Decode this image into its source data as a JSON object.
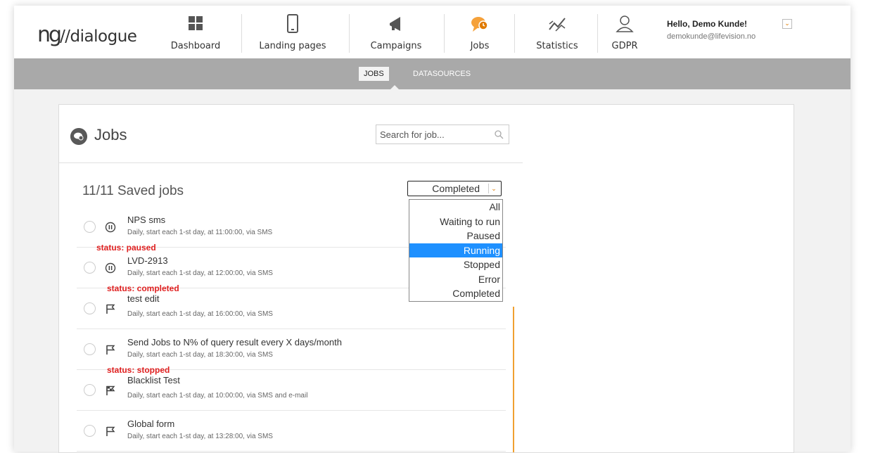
{
  "logo": {
    "prefix": "ng",
    "text": "//dialogue"
  },
  "nav": {
    "dashboard": "Dashboard",
    "landing_pages": "Landing pages",
    "campaigns": "Campaigns",
    "jobs": "Jobs",
    "statistics": "Statistics",
    "gdpr": "GDPR"
  },
  "user": {
    "greeting": "Hello, Demo Kunde!",
    "email": "demokunde@lifevision.no"
  },
  "subnav": {
    "jobs": "JOBS",
    "datasources": "DATASOURCES"
  },
  "jobs_panel": {
    "title": "Jobs",
    "search_placeholder": "Search for job...",
    "saved_title": "11/11 Saved jobs",
    "filter_value": "Completed",
    "filter_options": [
      "All",
      "Waiting to run",
      "Paused",
      "Running",
      "Stopped",
      "Error",
      "Completed"
    ]
  },
  "jobs": [
    {
      "name": "NPS sms",
      "desc": "Daily, start each 1-st day, at 11:00:00, via SMS",
      "icon": "pause-icon"
    },
    {
      "name": "LVD-2913",
      "desc": "Daily, start each 1-st day, at 12:00:00, via SMS",
      "icon": "pause-icon"
    },
    {
      "name": "test edit",
      "desc": "Daily, start each 1-st day, at 16:00:00, via SMS",
      "icon": "flag-icon"
    },
    {
      "name": "Send Jobs to N% of query result every X days/month",
      "desc": "Daily, start each 1-st day, at 18:30:00, via SMS",
      "icon": "flag-icon"
    },
    {
      "name": "Blacklist Test",
      "desc": "Daily, start each 1-st day, at 10:00:00, via SMS and e-mail",
      "icon": "checkered-flag-icon"
    },
    {
      "name": "Global form",
      "desc": "Daily, start each 1-st day, at 13:28:00, via SMS",
      "icon": "flag-icon"
    }
  ],
  "annotations": {
    "paused": "status: paused",
    "completed": "status: completed",
    "stopped": "status: stopped"
  },
  "colors": {
    "accent": "#e07b00",
    "annotation": "#e02020",
    "subbar": "#a9a9a9",
    "selected_option": "#1e90ff"
  }
}
